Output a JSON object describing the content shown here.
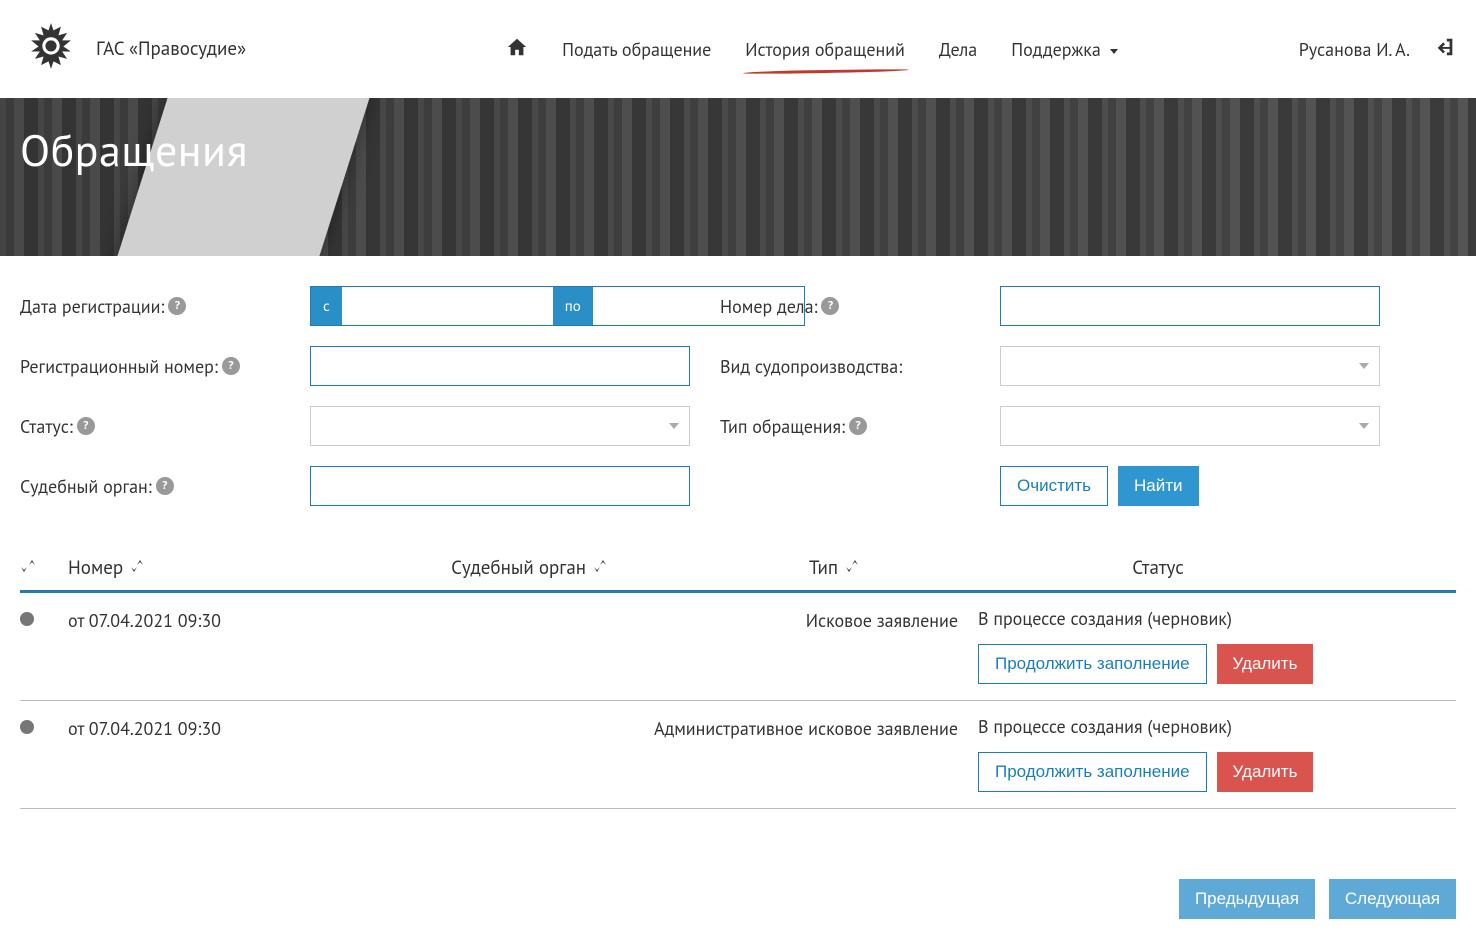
{
  "brand": "ГАС «Правосудие»",
  "nav": {
    "submit": "Подать обращение",
    "history": "История обращений",
    "cases": "Дела",
    "support": "Поддержка"
  },
  "user": {
    "name": "Русанова И. А."
  },
  "hero": {
    "title": "Обращения"
  },
  "filters": {
    "date_label": "Дата регистрации:",
    "date_from_tag": "с",
    "date_to_tag": "по",
    "reg_number_label": "Регистрационный номер:",
    "status_label": "Статус:",
    "court_label": "Судебный орган:",
    "case_number_label": "Номер дела:",
    "proc_type_label": "Вид судопроизводства:",
    "appeal_type_label": "Тип обращения:",
    "clear_btn": "Очистить",
    "find_btn": "Найти"
  },
  "table": {
    "headers": {
      "number": "Номер",
      "court": "Судебный орган",
      "type": "Тип",
      "status": "Статус"
    },
    "rows": [
      {
        "date": "от 07.04.2021 09:30",
        "type": "Исковое заявление",
        "status": "В процессе создания (черновик)",
        "continue": "Продолжить заполнение",
        "delete": "Удалить"
      },
      {
        "date": "от 07.04.2021 09:30",
        "type": "Административное исковое заявление",
        "status": "В процессе создания (черновик)",
        "continue": "Продолжить заполнение",
        "delete": "Удалить"
      }
    ]
  },
  "pager": {
    "prev": "Предыдущая",
    "next": "Следующая"
  }
}
